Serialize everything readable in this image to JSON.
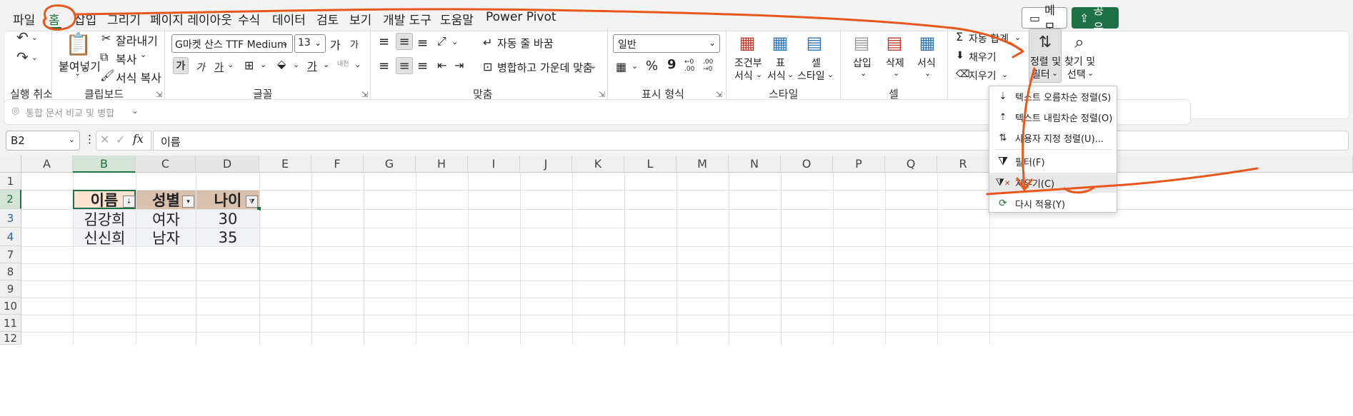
{
  "menu": {
    "tabs": [
      "파일",
      "홈",
      "삽입",
      "그리기",
      "페이지 레이아웃",
      "수식",
      "데이터",
      "검토",
      "보기",
      "개발 도구",
      "도움말",
      "Power Pivot"
    ],
    "active_tab": "홈",
    "memo_label": "메모",
    "share_label": "공유"
  },
  "ribbon": {
    "undo_group": "실행 취소",
    "clipboard": {
      "label": "클립보드",
      "paste": "붙여넣기",
      "cut": "잘라내기",
      "copy": "복사",
      "format_painter": "서식 복사"
    },
    "font": {
      "label": "글꼴",
      "font_name": "G마켓 산스 TTF Medium",
      "font_size": "13",
      "grow": "가",
      "shrink": "가",
      "bold": "가",
      "italic": "가",
      "underline": "가",
      "font_color": "가",
      "phonetic": "내천"
    },
    "alignment": {
      "label": "맞춤",
      "wrap_text": "자동 줄 바꿈",
      "merge_center": "병합하고 가운데 맞춤"
    },
    "number": {
      "label": "표시 형식",
      "format": "일반",
      "percent": "%",
      "comma": "9",
      "inc_decimal": "←0\n.00",
      "dec_decimal": ".00\n→0"
    },
    "styles": {
      "label": "스타일",
      "conditional": [
        "조건부",
        "서식"
      ],
      "table": [
        "표",
        "서식"
      ],
      "cell": [
        "셀",
        "스타일"
      ]
    },
    "cells": {
      "label": "셀",
      "insert": "삽입",
      "delete": "삭제",
      "format": "서식"
    },
    "editing": {
      "autosum": "자동 합계",
      "fill": "채우기",
      "clear": "지우기",
      "sort_filter": [
        "정렬 및",
        "필터"
      ],
      "find_select": [
        "찾기 및",
        "선택"
      ]
    }
  },
  "compare_bar": {
    "label": "통합 문서 비교 및 병합"
  },
  "formula_bar": {
    "name_box": "B2",
    "fx": "fx",
    "content": "이름"
  },
  "sheet": {
    "columns": [
      "A",
      "B",
      "C",
      "D",
      "E",
      "F",
      "G",
      "H",
      "I",
      "J",
      "K",
      "L",
      "M",
      "N",
      "O",
      "P",
      "Q",
      "R"
    ],
    "rows": [
      "1",
      "2",
      "3",
      "4",
      "7",
      "8",
      "9",
      "10",
      "11",
      "12"
    ],
    "table": {
      "headers": [
        "이름",
        "성별",
        "나이"
      ],
      "rows": [
        [
          "김강희",
          "여자",
          "30"
        ],
        [
          "신신희",
          "남자",
          "35"
        ]
      ]
    }
  },
  "dropdown": {
    "items": [
      {
        "icon": "sort-asc-icon",
        "label": "텍스트 오름차순 정렬(S)"
      },
      {
        "icon": "sort-desc-icon",
        "label": "텍스트 내림차순 정렬(O)"
      },
      {
        "icon": "custom-sort-icon",
        "label": "사용자 지정 정렬(U)..."
      },
      {
        "icon": "filter-icon",
        "label": "필터(F)"
      },
      {
        "icon": "clear-filter-icon",
        "label": "지우기(C)"
      },
      {
        "icon": "reapply-icon",
        "label": "다시 적용(Y)"
      }
    ]
  },
  "colors": {
    "accent": "#1e7145",
    "annotation": "#e8571c",
    "table_header": "#d8c0ad",
    "table_header_first": "#fde3d0",
    "table_data": "#f1f2f6"
  }
}
